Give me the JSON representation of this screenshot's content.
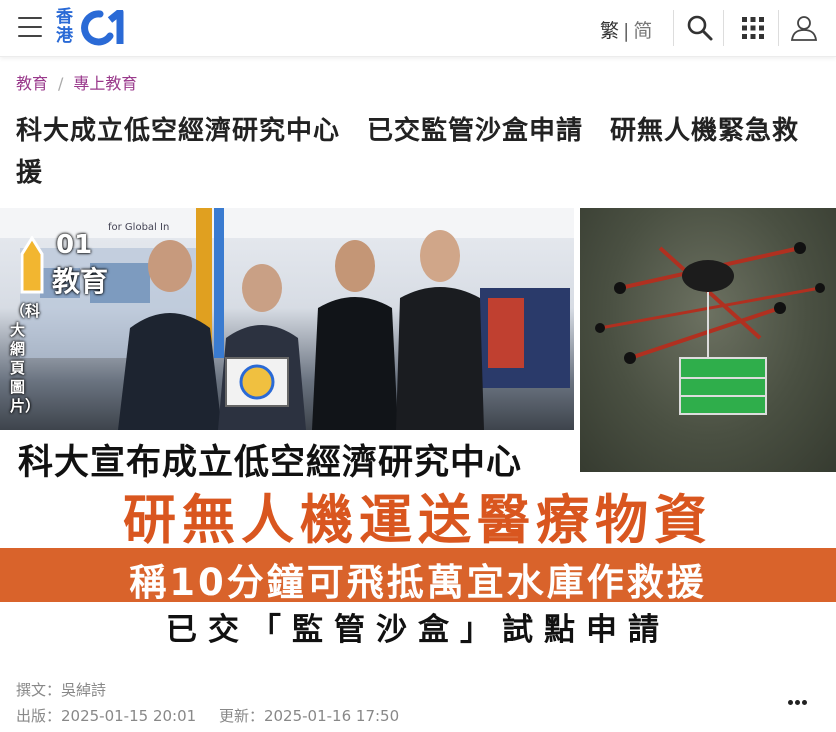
{
  "header": {
    "logo_hk": "香港",
    "logo_num": "01",
    "lang_trad": "繁",
    "lang_sep": "|",
    "lang_simp": "简"
  },
  "breadcrumb": {
    "level1": "教育",
    "separator": "/",
    "level2": "專上教育"
  },
  "article": {
    "headline": "科大成立低空經濟研究中心　已交監管沙盒申請　研無人機緊急救援",
    "author": "撰文：吳綽詩",
    "published": "出版：2025-01-15 20:01",
    "updated": "更新：2025-01-16 17:50"
  },
  "hero": {
    "badge_num": "01",
    "badge_label": "教育",
    "photo_credit": "（科大網頁圖片）",
    "backdrop_text": "for Global In",
    "line1": "科大宣布成立低空經濟研究中心",
    "line2": "研無人機運送醫療物資",
    "line3": "稱10分鐘可飛抵萬宜水庫作救援",
    "line4": "已交「監管沙盒」試點申請"
  },
  "colors": {
    "brand_blue": "#2a6ad6",
    "breadcrumb_purple": "#9a3a8c",
    "accent_orange": "#d9632b"
  },
  "icons": [
    "menu-icon",
    "search-icon",
    "apps-grid-icon",
    "user-icon",
    "more-options-icon"
  ]
}
